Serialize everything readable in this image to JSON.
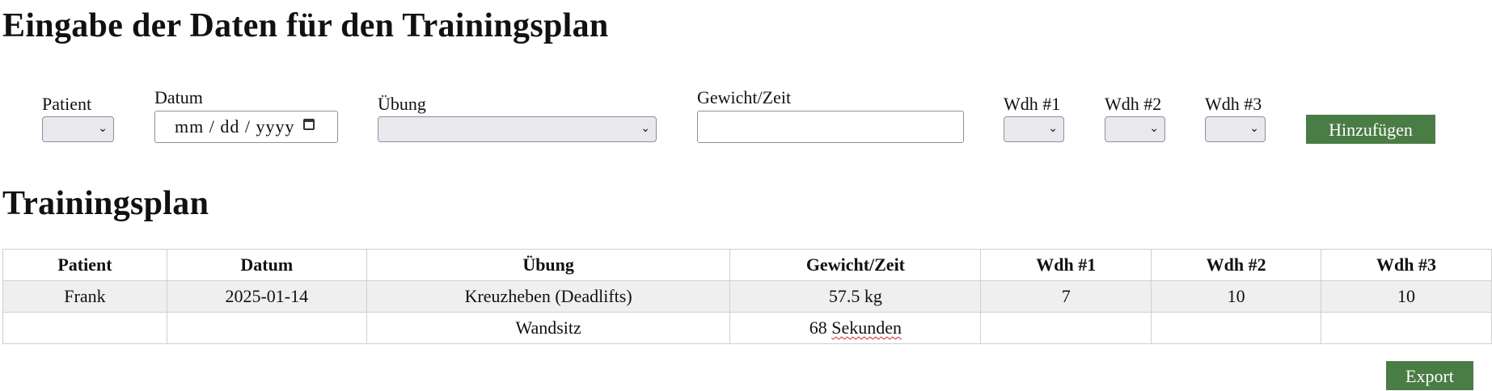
{
  "page": {
    "title": "Eingabe der Daten für den Trainingsplan",
    "plan_heading": "Trainingsplan"
  },
  "form": {
    "patient_label": "Patient",
    "datum_label": "Datum",
    "datum_placeholder": "mm / dd / yyyy",
    "uebung_label": "Übung",
    "gewicht_label": "Gewicht/Zeit",
    "wdh1_label": "Wdh #1",
    "wdh2_label": "Wdh #2",
    "wdh3_label": "Wdh #3",
    "add_button": "Hinzufügen"
  },
  "table": {
    "headers": [
      "Patient",
      "Datum",
      "Übung",
      "Gewicht/Zeit",
      "Wdh #1",
      "Wdh #2",
      "Wdh #3"
    ],
    "rows": [
      [
        "Frank",
        "2025-01-14",
        "Kreuzheben (Deadlifts)",
        "57.5 kg",
        "7",
        "10",
        "10"
      ],
      [
        "",
        "",
        "Wandsitz",
        "68 Sekunden",
        "",
        "",
        ""
      ]
    ]
  },
  "export_button": "Export",
  "colors": {
    "accent": "#4a7c45"
  }
}
